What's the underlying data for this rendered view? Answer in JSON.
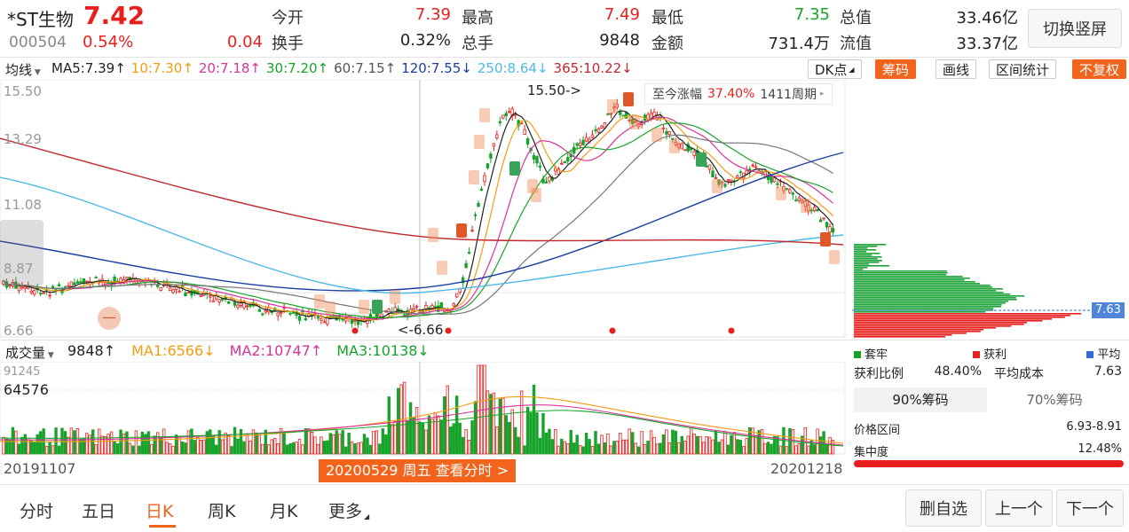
{
  "header": {
    "name": "*ST生物",
    "code": "000504",
    "price": "7.42",
    "change_pct": "0.54%",
    "change_amt": "0.04",
    "fields": [
      {
        "label": "今开",
        "value": "7.39",
        "color": "red"
      },
      {
        "label": "最高",
        "value": "7.49",
        "color": "red"
      },
      {
        "label": "最低",
        "value": "7.35",
        "color": "green"
      },
      {
        "label": "总值",
        "value": "33.46亿",
        "color": "black"
      },
      {
        "label": "换手",
        "value": "0.32%",
        "color": "black"
      },
      {
        "label": "总手",
        "value": "9848",
        "color": "black"
      },
      {
        "label": "金额",
        "value": "731.4万",
        "color": "black"
      },
      {
        "label": "流值",
        "value": "33.37亿",
        "color": "black"
      }
    ],
    "switch_label": "切换竖屏"
  },
  "ma_bar": {
    "selector": "均线",
    "items": [
      {
        "text": "MA5:7.39↑",
        "color": "#222222"
      },
      {
        "text": "10:7.30↑",
        "color": "#f39c12"
      },
      {
        "text": "20:7.18↑",
        "color": "#d6339b"
      },
      {
        "text": "30:7.20↑",
        "color": "#17a32a"
      },
      {
        "text": "60:7.15↑",
        "color": "#555555"
      },
      {
        "text": "120:7.55↓",
        "color": "#1b3fa0"
      },
      {
        "text": "250:8.64↓",
        "color": "#4cb9e8"
      },
      {
        "text": "365:10.22↓",
        "color": "#c0282d"
      }
    ],
    "buttons": {
      "dk": "DK点",
      "chip": "筹码",
      "draw": "画线",
      "range": "区间统计",
      "adjust": "不复权"
    }
  },
  "kline": {
    "y_labels": [
      "15.50",
      "13.29",
      "11.08",
      "8.87",
      "6.66"
    ],
    "max_label": "15.50->",
    "min_label": "<-6.66",
    "info_text": "至今涨幅",
    "info_pct": "37.40%",
    "info_period": "1411周期",
    "info_arrow": "▸",
    "left_marker": "—"
  },
  "volume": {
    "selector": "成交量",
    "value": "9848↑",
    "ma1": "MA1:6566↓",
    "ma2": "MA2:10747↑",
    "ma3": "MA3:10138↓",
    "y_top": "91245",
    "y_mid": "64576",
    "colors": {
      "ma1": "#f39c12",
      "ma2": "#d6339b",
      "ma3": "#17a32a"
    }
  },
  "dates": {
    "start": "20191107",
    "end": "20201218",
    "highlight": "20200529 周五 查看分时 >"
  },
  "chip_panel": {
    "current_price": "7.63",
    "legend": [
      {
        "label": "套牢",
        "color": "#17a32a"
      },
      {
        "label": "获利",
        "color": "#e8201d"
      },
      {
        "label": "平均",
        "color": "#2f6fd6"
      }
    ],
    "profit_ratio_label": "获利比例",
    "profit_ratio": "48.40%",
    "avg_cost_label": "平均成本",
    "avg_cost": "7.63",
    "tab_90": "90%筹码",
    "tab_70": "70%筹码",
    "range_label": "价格区间",
    "range_value": "6.93-8.91",
    "conc_label": "集中度",
    "conc_value": "12.48%"
  },
  "bottom_tabs": [
    "分时",
    "五日",
    "日K",
    "周K",
    "月K",
    "更多"
  ],
  "active_tab": "日K",
  "bottom_buttons": {
    "watchlist": "删自选",
    "prev": "上一个",
    "next": "下一个"
  }
}
